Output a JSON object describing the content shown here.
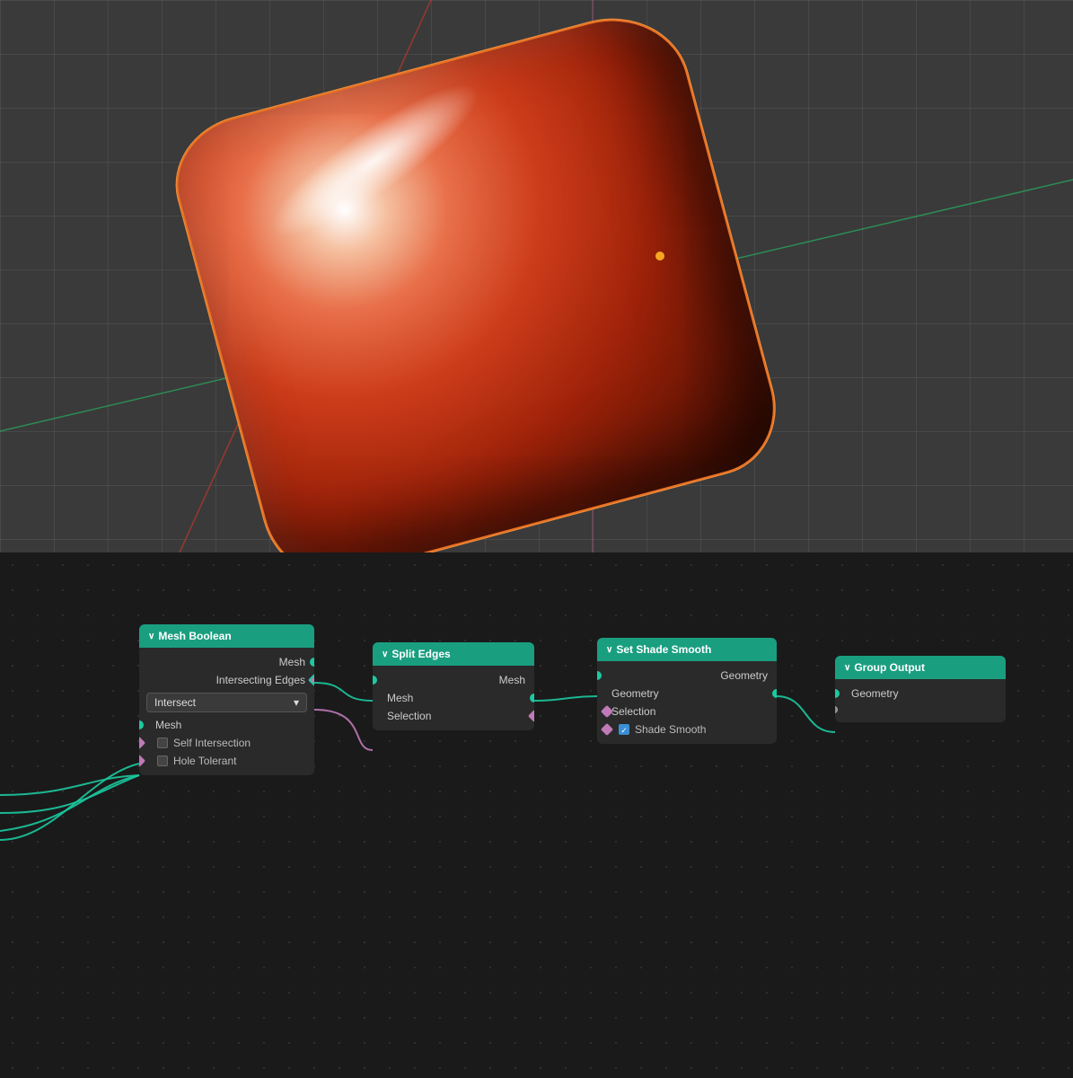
{
  "viewport": {
    "label": "3D Viewport"
  },
  "node_editor": {
    "label": "Geometry Node Editor"
  },
  "nodes": {
    "mesh_boolean": {
      "title": "Mesh Boolean",
      "collapse_icon": "∨",
      "sockets": {
        "mesh_label": "Mesh",
        "intersecting_edges_label": "Intersecting Edges"
      },
      "dropdown": {
        "value": "Intersect",
        "arrow": "▾"
      },
      "mesh_input_label": "Mesh",
      "checkboxes": [
        {
          "label": "Self Intersection",
          "checked": false
        },
        {
          "label": "Hole Tolerant",
          "checked": false
        }
      ]
    },
    "split_edges": {
      "title": "Split Edges",
      "collapse_icon": "∨",
      "sockets": {
        "mesh_input": "Mesh",
        "mesh_output": "Mesh",
        "selection_output": "Selection"
      }
    },
    "set_shade_smooth": {
      "title": "Set Shade Smooth",
      "collapse_icon": "∨",
      "sockets": {
        "geometry_input": "Geometry",
        "geometry_output": "Geometry",
        "selection_output": "Selection",
        "shade_smooth_label": "Shade Smooth"
      }
    },
    "group_output": {
      "title": "Group Output",
      "collapse_icon": "∨",
      "sockets": {
        "geometry_input": "Geometry"
      },
      "geometry_label": "Geometry"
    }
  },
  "colors": {
    "node_header": "#1a9e80",
    "socket_green": "#1cc9a0",
    "socket_purple": "#c07ab8",
    "socket_blue": "#3a8fd4",
    "node_bg": "#2a2a2a",
    "editor_bg": "#1a1a1a"
  }
}
